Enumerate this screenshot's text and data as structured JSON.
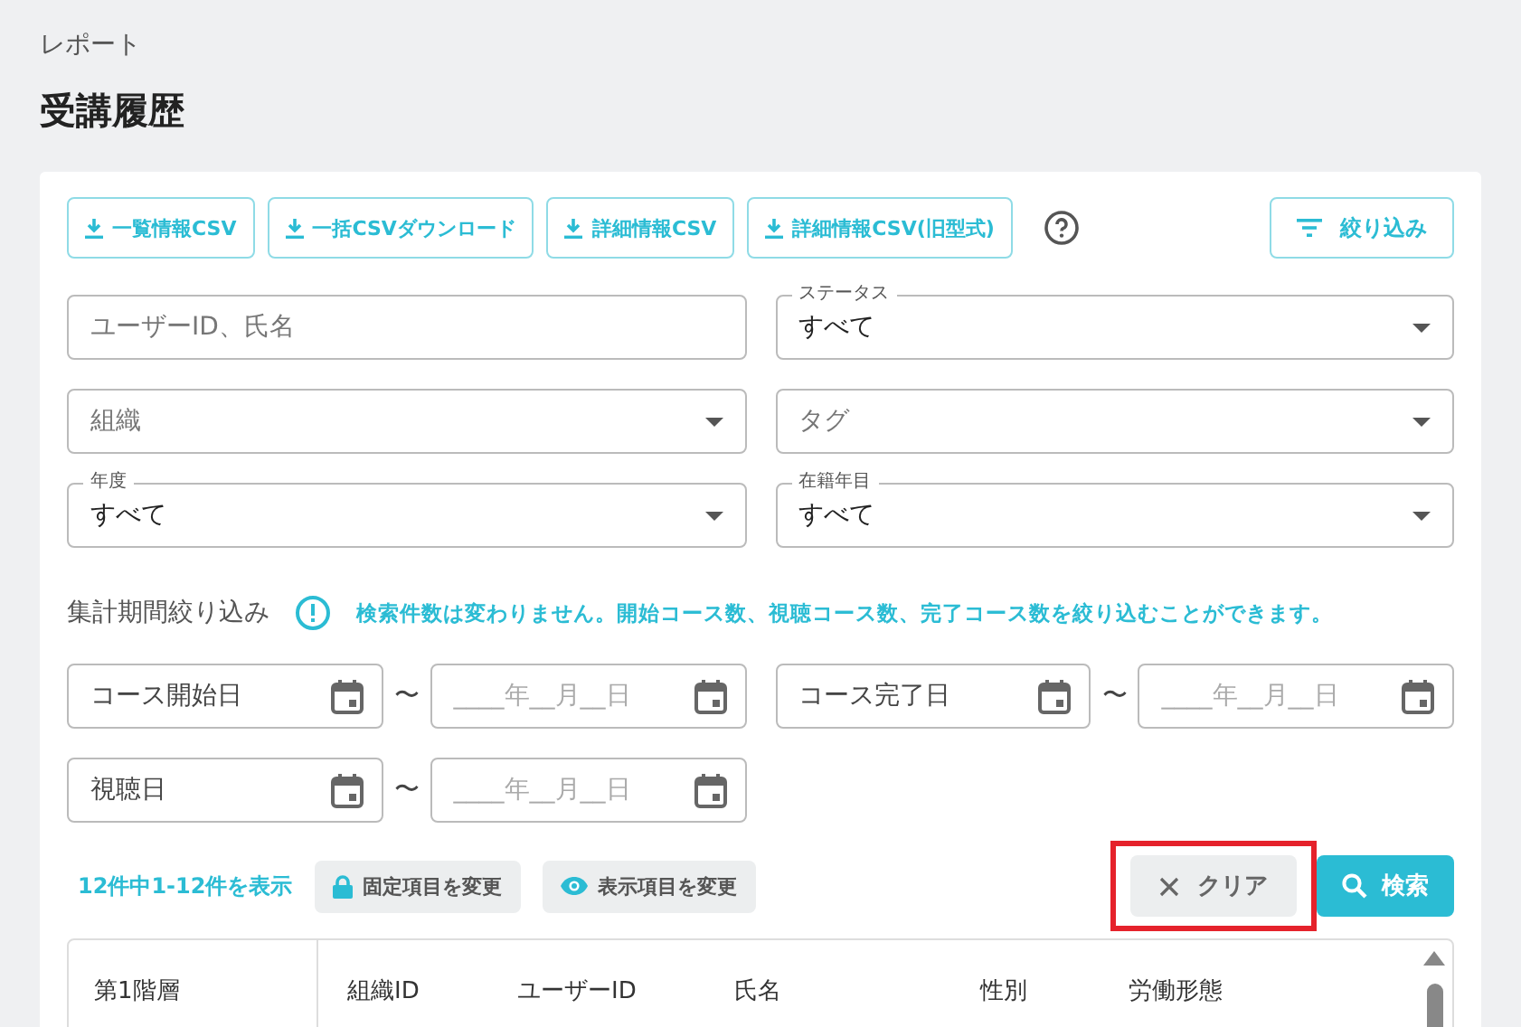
{
  "breadcrumb": "レポート",
  "title": "受講履歴",
  "export_buttons": [
    {
      "label": "一覧情報CSV"
    },
    {
      "label": "一括CSVダウンロード"
    },
    {
      "label": "詳細情報CSV"
    },
    {
      "label": "詳細情報CSV(旧型式)"
    }
  ],
  "filter_button": "絞り込み",
  "filter_rows": [
    {
      "fields": [
        {
          "kind": "text",
          "placeholder": "ユーザーID、氏名"
        },
        {
          "kind": "select",
          "label": "ステータス",
          "value": "すべて"
        }
      ]
    },
    {
      "fields": [
        {
          "kind": "select",
          "placeholder": "組織"
        },
        {
          "kind": "select",
          "placeholder": "タグ"
        }
      ]
    },
    {
      "fields": [
        {
          "kind": "select",
          "label": "年度",
          "value": "すべて"
        },
        {
          "kind": "select",
          "label": "在籍年目",
          "value": "すべて"
        }
      ]
    }
  ],
  "period": {
    "label": "集計期間絞り込み",
    "notice": "検索件数は変わりません。開始コース数、視聴コース数、完了コース数を絞り込むことができます。"
  },
  "date_ranges": [
    {
      "from": "コース開始日",
      "to": "____年__月__日",
      "separator": "〜"
    },
    {
      "from": "コース完了日",
      "to": "____年__月__日",
      "separator": "〜"
    },
    {
      "from": "視聴日",
      "to": "____年__月__日",
      "separator": "〜"
    }
  ],
  "result_count": "12件中1-12件を表示",
  "column_buttons": [
    {
      "kind": "lock",
      "label": "固定項目を変更"
    },
    {
      "kind": "eye",
      "label": "表示項目を変更"
    }
  ],
  "clear_button": {
    "label": "クリア",
    "highlighted": true
  },
  "search_button": "検索",
  "table": {
    "fixed_columns": [
      "第1階層"
    ],
    "columns": [
      "組織ID",
      "ユーザーID",
      "氏名",
      "性別",
      "労働形態"
    ]
  }
}
